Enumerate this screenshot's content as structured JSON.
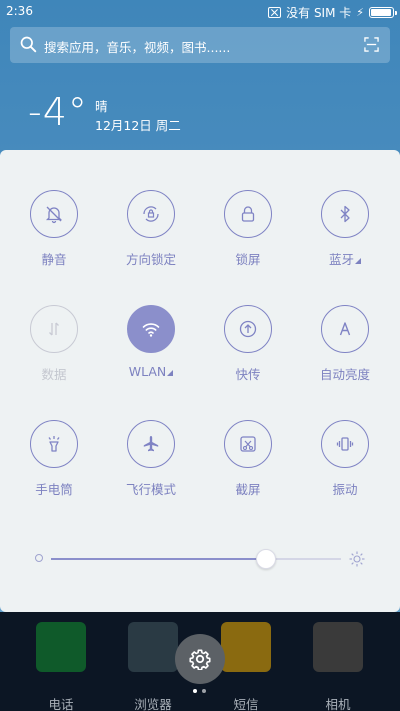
{
  "status_bar": {
    "time": "2:36",
    "sim_status": "没有 SIM 卡",
    "battery_level": 0.85
  },
  "search": {
    "placeholder": "搜索应用，音乐，视频，图书......"
  },
  "weather": {
    "temperature": "-4°",
    "condition": "晴",
    "date": "12月12日 周二"
  },
  "quick_settings": {
    "tiles": [
      {
        "label": "静音",
        "icon": "bell-off-icon",
        "active": false,
        "enabled": true
      },
      {
        "label": "方向锁定",
        "icon": "rotation-lock-icon",
        "active": false,
        "enabled": true
      },
      {
        "label": "锁屏",
        "icon": "lock-icon",
        "active": false,
        "enabled": true
      },
      {
        "label": "蓝牙",
        "icon": "bluetooth-icon",
        "active": false,
        "enabled": true,
        "expandable": true
      },
      {
        "label": "数据",
        "icon": "mobile-data-icon",
        "active": false,
        "enabled": false
      },
      {
        "label": "WLAN",
        "icon": "wifi-icon",
        "active": true,
        "enabled": true,
        "expandable": true
      },
      {
        "label": "快传",
        "icon": "quick-transfer-icon",
        "active": false,
        "enabled": true
      },
      {
        "label": "自动亮度",
        "icon": "auto-brightness-icon",
        "active": false,
        "enabled": true
      },
      {
        "label": "手电筒",
        "icon": "flashlight-icon",
        "active": false,
        "enabled": true
      },
      {
        "label": "飞行模式",
        "icon": "airplane-icon",
        "active": false,
        "enabled": true
      },
      {
        "label": "截屏",
        "icon": "screenshot-icon",
        "active": false,
        "enabled": true
      },
      {
        "label": "振动",
        "icon": "vibrate-icon",
        "active": false,
        "enabled": true
      }
    ],
    "brightness": 0.74,
    "accent_color": "#8b8fcb"
  },
  "dock": {
    "apps": [
      {
        "label": "电话",
        "icon": "phone-icon",
        "color": "#0f5a2a"
      },
      {
        "label": "浏览器",
        "icon": "browser-icon",
        "color": "#2a3a44"
      },
      {
        "label": "短信",
        "icon": "messages-icon",
        "color": "#8a6a10"
      },
      {
        "label": "相机",
        "icon": "camera-icon",
        "color": "#3a3a3a"
      }
    ]
  },
  "page_indicator": {
    "pages": 2,
    "current": 1
  }
}
